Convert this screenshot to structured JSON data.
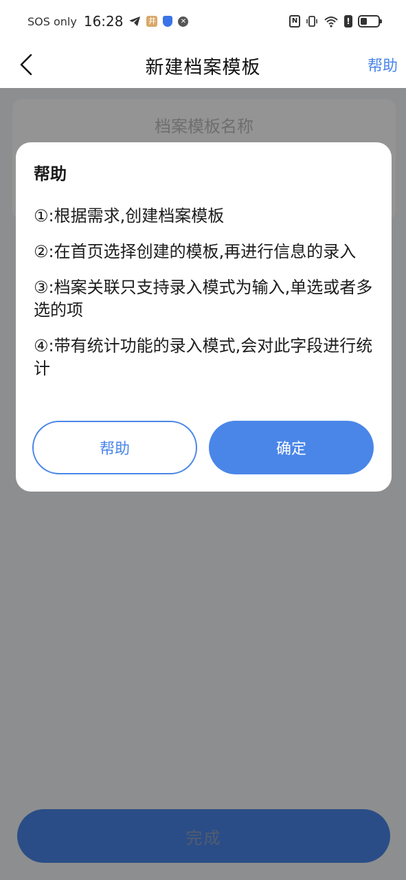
{
  "status_bar": {
    "carrier": "SOS only",
    "time": "16:28",
    "icons": [
      "telegram-icon",
      "app-icon",
      "shield-icon",
      "vpn-icon",
      "nfc-icon",
      "vibrate-icon",
      "wifi-icon",
      "alert-icon",
      "battery-icon"
    ]
  },
  "nav": {
    "title": "新建档案模板",
    "help_label": "帮助"
  },
  "form": {
    "name_placeholder": "档案模板名称"
  },
  "footer": {
    "done_label": "完成"
  },
  "dialog": {
    "title": "帮助",
    "items": [
      "①:根据需求,创建档案模板",
      "②:在首页选择创建的模板,再进行信息的录入",
      "③:档案关联只支持录入模式为输入,单选或者多选的项",
      "④:带有统计功能的录入模式,会对此字段进行统计"
    ],
    "help_button": "帮助",
    "confirm_button": "确定"
  },
  "colors": {
    "accent": "#4a86e8",
    "overlay": "#000000"
  }
}
